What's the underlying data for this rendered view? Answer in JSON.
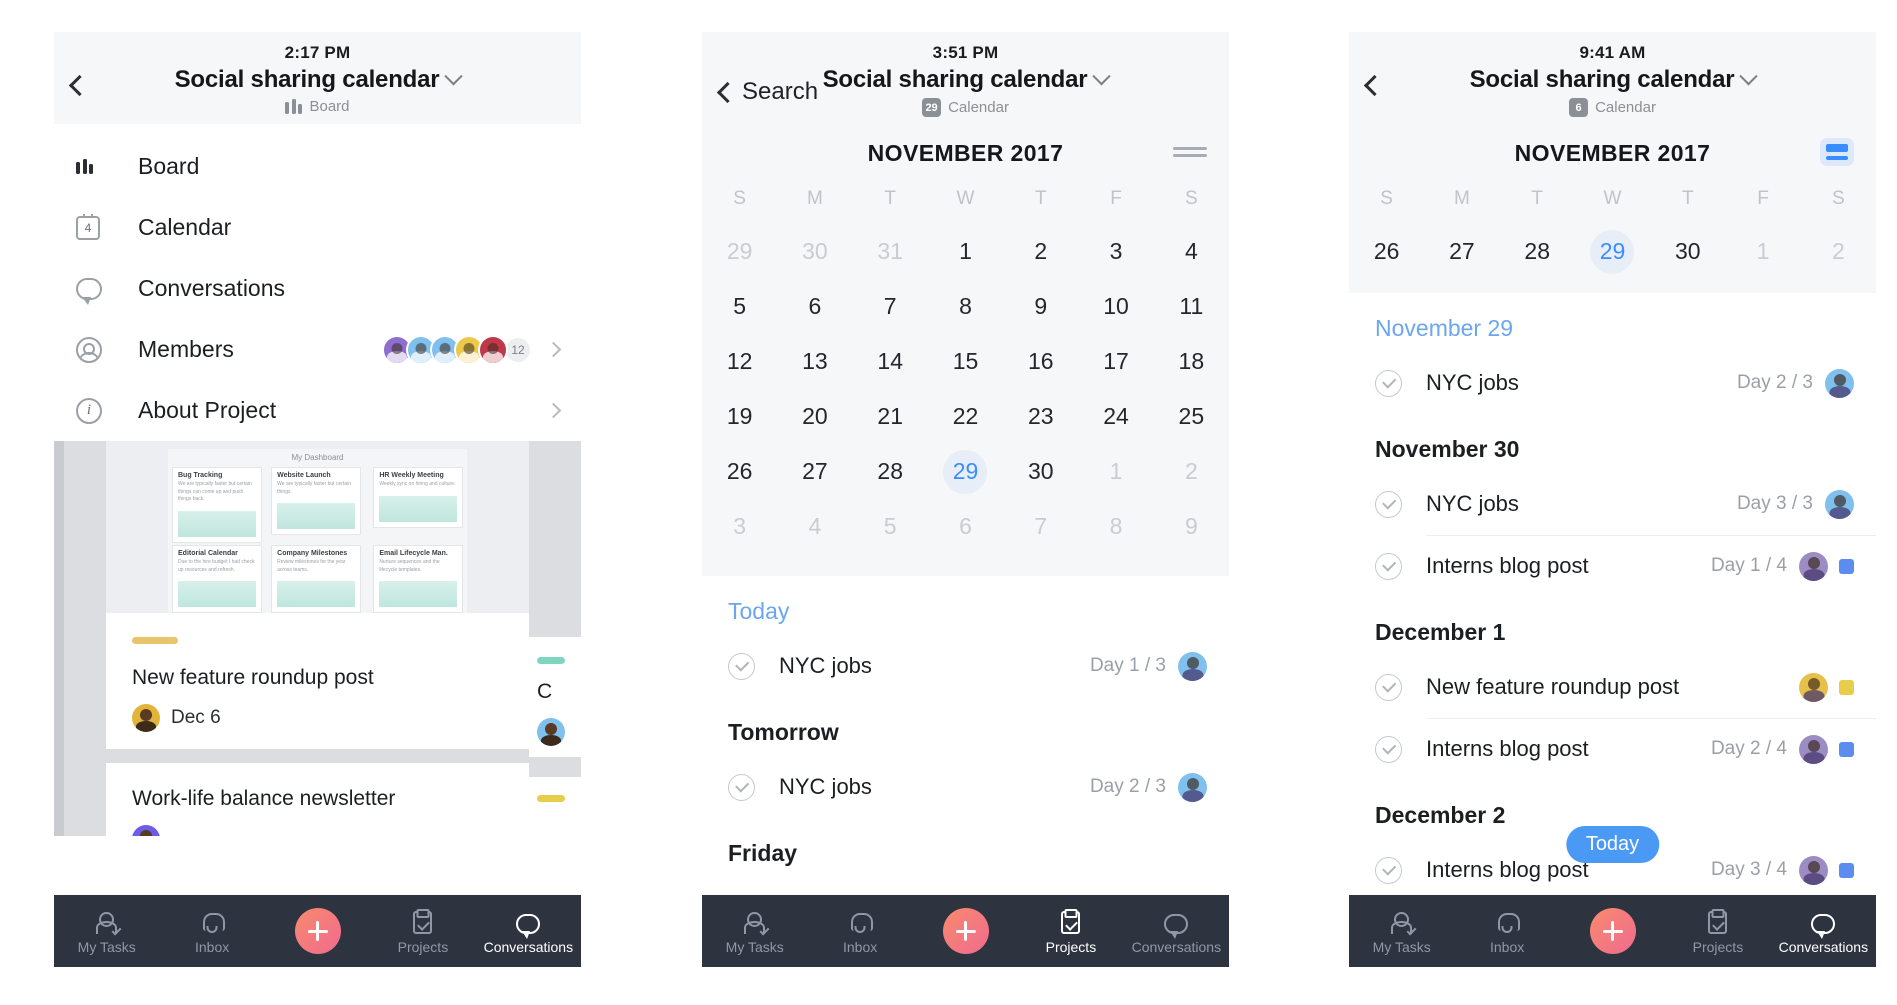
{
  "screens": [
    {
      "id": "board-menu",
      "nav": {
        "time": "2:17 PM",
        "title": "Social sharing calendar",
        "subtitle": "Board",
        "subtitle_icon": "board-icon",
        "back_label": ""
      },
      "menu": [
        {
          "label": "Board",
          "icon": "board-icon"
        },
        {
          "label": "Calendar",
          "icon": "calendar-icon",
          "badge": "4"
        },
        {
          "label": "Conversations",
          "icon": "chat-bubble-icon"
        },
        {
          "label": "Members",
          "icon": "person-icon",
          "member_count": "12"
        },
        {
          "label": "About Project",
          "icon": "info-icon"
        }
      ],
      "board_preview": {
        "dashboard_title": "My Dashboard",
        "columns": [
          {
            "title": "Bug Tracking",
            "body": "We are typically faster but certain things can come up and push things back."
          },
          {
            "title": "Website Launch",
            "body": "We are typically faster but certain things."
          },
          {
            "title": "HR Weekly Meeting",
            "body": "Weekly sync on hiring and culture."
          },
          {
            "title": "Editorial Calendar",
            "body": "Due to the hire budget I had check up resources and refresh."
          },
          {
            "title": "Company Milestones",
            "body": "Review milestones for the year across teams."
          },
          {
            "title": "Email Lifecycle Man.",
            "body": "Nurture sequences and the lifecycle templates."
          }
        ],
        "cards": [
          {
            "title": "New feature roundup post",
            "date": "Dec 6"
          },
          {
            "title": "Work-life balance newsletter",
            "date": ""
          }
        ]
      },
      "tabs": [
        {
          "label": "My Tasks",
          "icon": "person-check-icon",
          "active": false
        },
        {
          "label": "Inbox",
          "icon": "bell-icon",
          "active": false
        },
        {
          "label": "",
          "icon": "add-icon",
          "active": false
        },
        {
          "label": "Projects",
          "icon": "clipboard-icon",
          "active": false
        },
        {
          "label": "Conversations",
          "icon": "chat-bubble-icon",
          "active": true
        }
      ]
    },
    {
      "id": "calendar-month",
      "nav": {
        "time": "3:51 PM",
        "title": "Social sharing calendar",
        "subtitle": "Calendar",
        "subtitle_badge": "29",
        "back_label": "Search"
      },
      "calendar": {
        "month": "NOVEMBER 2017",
        "toggle_icon": "list-view-icon",
        "toggle_active": false,
        "dow": [
          "S",
          "M",
          "T",
          "W",
          "T",
          "F",
          "S"
        ],
        "weeks": [
          [
            {
              "d": "29",
              "muted": true
            },
            {
              "d": "30",
              "muted": true
            },
            {
              "d": "31",
              "muted": true
            },
            {
              "d": "1"
            },
            {
              "d": "2"
            },
            {
              "d": "3"
            },
            {
              "d": "4"
            }
          ],
          [
            {
              "d": "5"
            },
            {
              "d": "6"
            },
            {
              "d": "7"
            },
            {
              "d": "8"
            },
            {
              "d": "9"
            },
            {
              "d": "10"
            },
            {
              "d": "11"
            }
          ],
          [
            {
              "d": "12"
            },
            {
              "d": "13"
            },
            {
              "d": "14"
            },
            {
              "d": "15"
            },
            {
              "d": "16"
            },
            {
              "d": "17"
            },
            {
              "d": "18"
            }
          ],
          [
            {
              "d": "19"
            },
            {
              "d": "20"
            },
            {
              "d": "21"
            },
            {
              "d": "22"
            },
            {
              "d": "23"
            },
            {
              "d": "24"
            },
            {
              "d": "25"
            }
          ],
          [
            {
              "d": "26"
            },
            {
              "d": "27"
            },
            {
              "d": "28"
            },
            {
              "d": "29",
              "today": true
            },
            {
              "d": "30"
            },
            {
              "d": "1",
              "muted": true
            },
            {
              "d": "2",
              "muted": true
            }
          ],
          [
            {
              "d": "3",
              "muted": true
            },
            {
              "d": "4",
              "muted": true
            },
            {
              "d": "5",
              "muted": true
            },
            {
              "d": "6",
              "muted": true
            },
            {
              "d": "7",
              "muted": true
            },
            {
              "d": "8",
              "muted": true
            },
            {
              "d": "9",
              "muted": true
            }
          ]
        ]
      },
      "groups": [
        {
          "title": "Today",
          "is_today": true,
          "tasks": [
            {
              "name": "NYC jobs",
              "days": "Day 1 / 3",
              "avatar": "#7fc0ee",
              "square": ""
            }
          ]
        },
        {
          "title": "Tomorrow",
          "is_today": false,
          "tasks": [
            {
              "name": "NYC jobs",
              "days": "Day 2 / 3",
              "avatar": "#7fc0ee",
              "square": ""
            }
          ]
        },
        {
          "title": "Friday",
          "is_today": false,
          "tasks": []
        }
      ],
      "tabs": [
        {
          "label": "My Tasks",
          "icon": "person-check-icon",
          "active": false
        },
        {
          "label": "Inbox",
          "icon": "bell-icon",
          "active": false
        },
        {
          "label": "",
          "icon": "add-icon",
          "active": false
        },
        {
          "label": "Projects",
          "icon": "clipboard-icon",
          "active": true
        },
        {
          "label": "Conversations",
          "icon": "chat-bubble-icon",
          "active": false
        }
      ]
    },
    {
      "id": "calendar-week",
      "nav": {
        "time": "9:41 AM",
        "title": "Social sharing calendar",
        "subtitle": "Calendar",
        "subtitle_badge": "6",
        "back_label": ""
      },
      "calendar": {
        "month": "NOVEMBER 2017",
        "toggle_icon": "list-view-icon",
        "toggle_active": true,
        "dow": [
          "S",
          "M",
          "T",
          "W",
          "T",
          "F",
          "S"
        ],
        "weeks": [
          [
            {
              "d": "26"
            },
            {
              "d": "27"
            },
            {
              "d": "28",
              "dot": true
            },
            {
              "d": "29",
              "today": true,
              "dot": true
            },
            {
              "d": "30",
              "dot": true
            },
            {
              "d": "1",
              "muted": true
            },
            {
              "d": "2",
              "muted": true
            }
          ]
        ]
      },
      "groups": [
        {
          "title": "November 29",
          "is_today": true,
          "tasks": [
            {
              "name": "NYC jobs",
              "days": "Day 2 / 3",
              "avatar": "#7fc0ee",
              "square": ""
            }
          ]
        },
        {
          "title": "November 30",
          "is_today": false,
          "tasks": [
            {
              "name": "NYC jobs",
              "days": "Day 3 / 3",
              "avatar": "#7fc0ee",
              "square": ""
            },
            {
              "name": "Interns blog post",
              "days": "Day 1 / 4",
              "avatar": "#9b8cc4",
              "square": "#5b8def"
            }
          ]
        },
        {
          "title": "December 1",
          "is_today": false,
          "tasks": [
            {
              "name": "New feature roundup post",
              "days": "",
              "avatar": "#e7c04a",
              "square": "#e8cd4d"
            },
            {
              "name": "Interns blog post",
              "days": "Day 2 / 4",
              "avatar": "#9b8cc4",
              "square": "#5b8def"
            }
          ]
        },
        {
          "title": "December 2",
          "is_today": false,
          "tasks": [
            {
              "name": "Interns blog post",
              "days": "Day 3 / 4",
              "avatar": "#9b8cc4",
              "square": "#5b8def"
            }
          ]
        }
      ],
      "today_pill": "Today",
      "tabs": [
        {
          "label": "My Tasks",
          "icon": "person-check-icon",
          "active": false
        },
        {
          "label": "Inbox",
          "icon": "bell-icon",
          "active": false
        },
        {
          "label": "",
          "icon": "add-icon",
          "active": false
        },
        {
          "label": "Projects",
          "icon": "clipboard-icon",
          "active": false
        },
        {
          "label": "Conversations",
          "icon": "chat-bubble-icon",
          "active": true
        }
      ]
    }
  ],
  "member_avatar_colors": [
    "#8e6fd0",
    "#7fc0ee",
    "#7fc0ee",
    "#ecc94b",
    "#c0394b"
  ],
  "colors": {
    "accent_blue": "#3a8dff",
    "link_blue": "#6ba6ef",
    "tabbar_bg": "#2e3340",
    "header_bg": "#f6f7f9",
    "muted_text": "#c8cdd2"
  }
}
